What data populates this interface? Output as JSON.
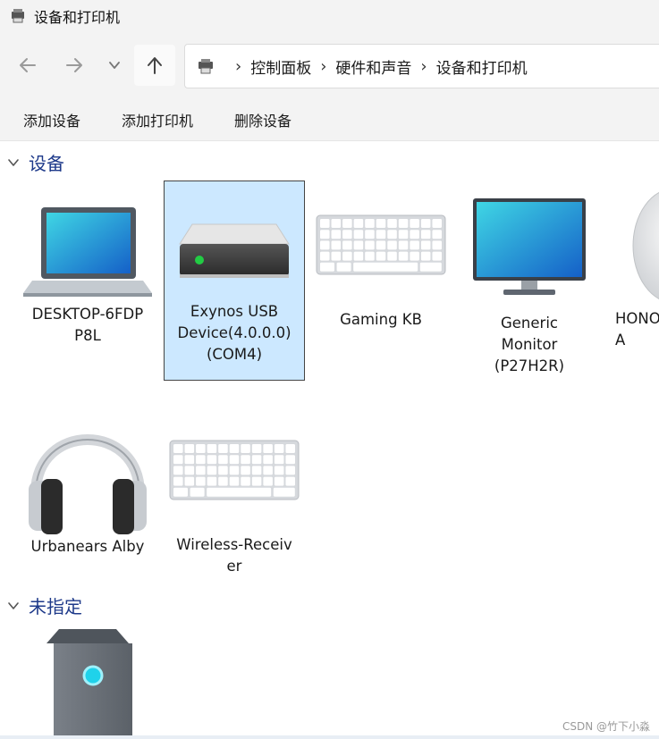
{
  "window": {
    "title": "设备和打印机",
    "app_icon": "devices-printers-icon"
  },
  "nav": {
    "back_icon": "arrow-left-icon",
    "forward_icon": "arrow-right-icon",
    "recent_icon": "chevron-down-icon",
    "up_icon": "arrow-up-icon",
    "breadcrumb": [
      "控制面板",
      "硬件和声音",
      "设备和打印机"
    ]
  },
  "commands": {
    "add_device": "添加设备",
    "add_printer": "添加打印机",
    "remove_device": "删除设备"
  },
  "sections": {
    "devices": {
      "title": "设备",
      "items": [
        {
          "label": "DESKTOP-6FDP\nP8L",
          "icon": "laptop-icon",
          "selected": false
        },
        {
          "label": "Exynos USB\nDevice(4.0.0.0)\n(COM4)",
          "icon": "drive-icon",
          "selected": true
        },
        {
          "label": "Gaming KB",
          "icon": "keyboard-icon",
          "selected": false
        },
        {
          "label": "Generic\nMonitor\n(P27H2R)",
          "icon": "monitor-icon",
          "selected": false
        },
        {
          "label": "HONO\nA",
          "icon": "earbuds-icon",
          "selected": false
        },
        {
          "label": "Urbanears Alby",
          "icon": "headphones-icon",
          "selected": false
        },
        {
          "label": "Wireless-Receiv\ner",
          "icon": "keyboard-icon",
          "selected": false
        }
      ]
    },
    "unspecified": {
      "title": "未指定",
      "items": [
        {
          "label": "",
          "icon": "tower-pc-icon",
          "selected": false
        }
      ]
    }
  },
  "watermark": "CSDN @竹下小淼",
  "colors": {
    "background": "#ffffff",
    "chrome": "#f3f3f3",
    "section_header": "#1e3a8a",
    "selection": "#cce8ff"
  }
}
